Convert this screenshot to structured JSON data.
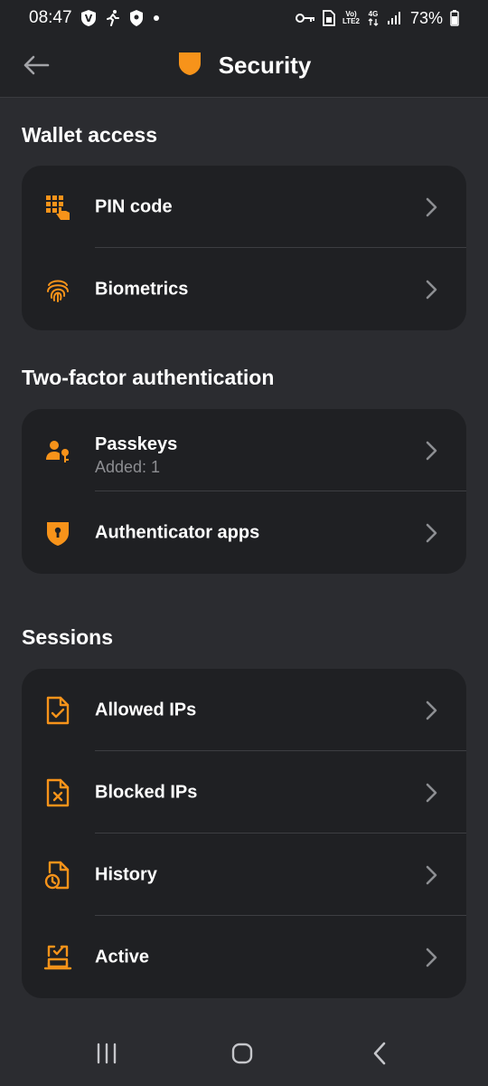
{
  "status_bar": {
    "time": "08:47",
    "network_small_top": "Vo)",
    "network_small_bottom": "LTE2",
    "network_4g": "4G",
    "battery_pct": "73%"
  },
  "app_bar": {
    "title": "Security"
  },
  "colors": {
    "accent": "#f7931a",
    "background": "#2b2c30",
    "card": "#1f2023",
    "subtext": "#8d8e92"
  },
  "sections": {
    "wallet": {
      "title": "Wallet access",
      "items": [
        {
          "label": "PIN code",
          "icon": "pin-pad-icon"
        },
        {
          "label": "Biometrics",
          "icon": "fingerprint-icon"
        }
      ]
    },
    "twofa": {
      "title": "Two-factor authentication",
      "items": [
        {
          "label": "Passkeys",
          "sub": "Added: 1",
          "icon": "user-key-icon"
        },
        {
          "label": "Authenticator apps",
          "icon": "shield-lock-icon"
        }
      ]
    },
    "sessions": {
      "title": "Sessions",
      "items": [
        {
          "label": "Allowed IPs",
          "icon": "document-check-icon"
        },
        {
          "label": "Blocked IPs",
          "icon": "document-x-icon"
        },
        {
          "label": "History",
          "icon": "document-clock-icon"
        },
        {
          "label": "Active",
          "icon": "device-check-icon"
        }
      ]
    }
  }
}
